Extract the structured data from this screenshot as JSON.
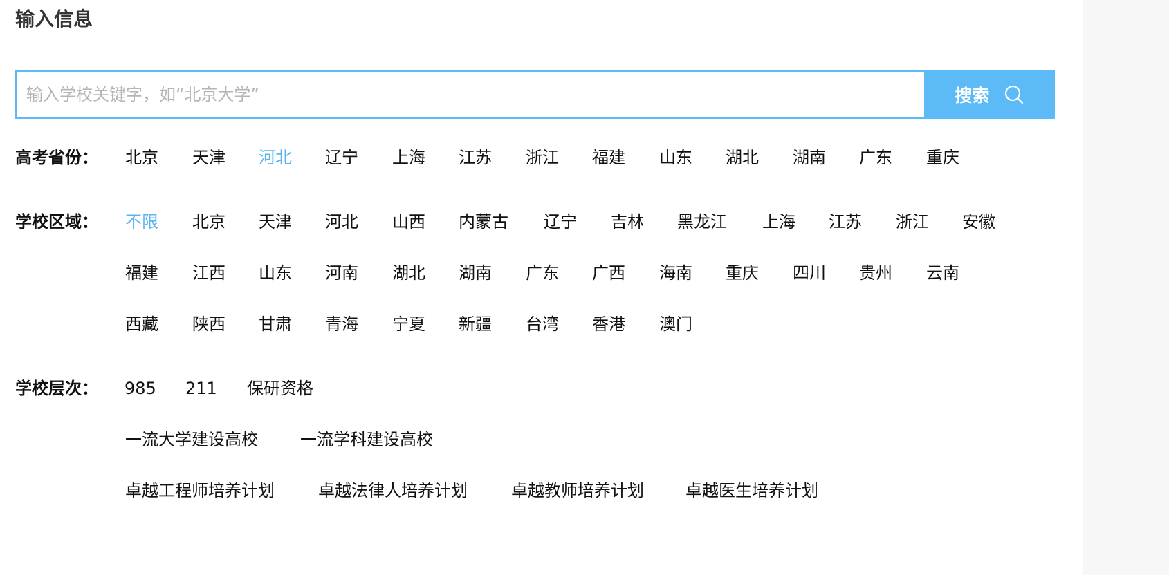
{
  "header": {
    "title": "输入信息"
  },
  "search": {
    "placeholder": "输入学校关键字，如“北京大学”",
    "value": "",
    "button_label": "搜索",
    "accent_color": "#5cbbf6"
  },
  "filters": {
    "province": {
      "label": "高考省份：",
      "options": [
        "北京",
        "天津",
        "河北",
        "辽宁",
        "上海",
        "江苏",
        "浙江",
        "福建",
        "山东",
        "湖北",
        "湖南",
        "广东",
        "重庆"
      ],
      "selected": "河北"
    },
    "region": {
      "label": "学校区域：",
      "options": [
        "不限",
        "北京",
        "天津",
        "河北",
        "山西",
        "内蒙古",
        "辽宁",
        "吉林",
        "黑龙江",
        "上海",
        "江苏",
        "浙江",
        "安徽",
        "福建",
        "江西",
        "山东",
        "河南",
        "湖北",
        "湖南",
        "广东",
        "广西",
        "海南",
        "重庆",
        "四川",
        "贵州",
        "云南",
        "西藏",
        "陕西",
        "甘肃",
        "青海",
        "宁夏",
        "新疆",
        "台湾",
        "香港",
        "澳门"
      ],
      "selected": "不限"
    },
    "level": {
      "label": "学校层次：",
      "options": [
        "985",
        "211",
        "保研资格",
        "一流大学建设高校",
        "一流学科建设高校",
        "卓越工程师培养计划",
        "卓越法律人培养计划",
        "卓越教师培养计划",
        "卓越医生培养计划"
      ]
    }
  },
  "colors": {
    "active_option": "#5cb4ef",
    "text": "#111111",
    "divider": "#dddddd"
  }
}
